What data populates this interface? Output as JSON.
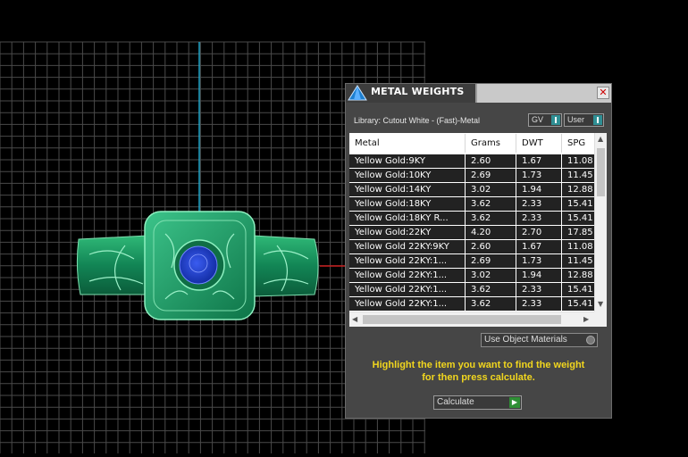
{
  "colors": {
    "background": "#000000",
    "grid": "#4a4a4a",
    "axis_y": "#22a6c8",
    "axis_x": "#c81e1e",
    "ring_green": "#16915a",
    "stone_blue": "#1f3fbf",
    "hint_yellow": "#f1d61e",
    "row_dark": "#222222"
  },
  "panel": {
    "title": "METAL WEIGHTS",
    "logo_icon": "pyramid-logo-icon",
    "close_icon": "close-icon",
    "close_glyph": "✕",
    "library_label": "Library: Cutout White - (Fast)-Metal",
    "toggles": {
      "gv": "GV",
      "user": "User"
    },
    "table": {
      "headers": [
        "Metal",
        "Grams",
        "DWT",
        "SPG"
      ],
      "rows": [
        [
          "Yellow Gold:9KY",
          "2.60",
          "1.67",
          "11.08"
        ],
        [
          "Yellow Gold:10KY",
          "2.69",
          "1.73",
          "11.45"
        ],
        [
          "Yellow Gold:14KY",
          "3.02",
          "1.94",
          "12.88"
        ],
        [
          "Yellow Gold:18KY",
          "3.62",
          "2.33",
          "15.41"
        ],
        [
          "Yellow Gold:18KY R...",
          "3.62",
          "2.33",
          "15.41"
        ],
        [
          "Yellow Gold:22KY",
          "4.20",
          "2.70",
          "17.85"
        ],
        [
          "Yellow Gold 22KY:9KY",
          "2.60",
          "1.67",
          "11.08"
        ],
        [
          "Yellow Gold 22KY:1...",
          "2.69",
          "1.73",
          "11.45"
        ],
        [
          "Yellow Gold 22KY:1...",
          "3.02",
          "1.94",
          "12.88"
        ],
        [
          "Yellow Gold 22KY:1...",
          "3.62",
          "2.33",
          "15.41"
        ],
        [
          "Yellow Gold 22KY:1...",
          "3.62",
          "2.33",
          "15.41"
        ]
      ]
    },
    "use_object_materials": "Use Object Materials",
    "hint_line1": "Highlight the item you want to find the weight",
    "hint_line2": "for then press calculate.",
    "calculate": "Calculate"
  }
}
